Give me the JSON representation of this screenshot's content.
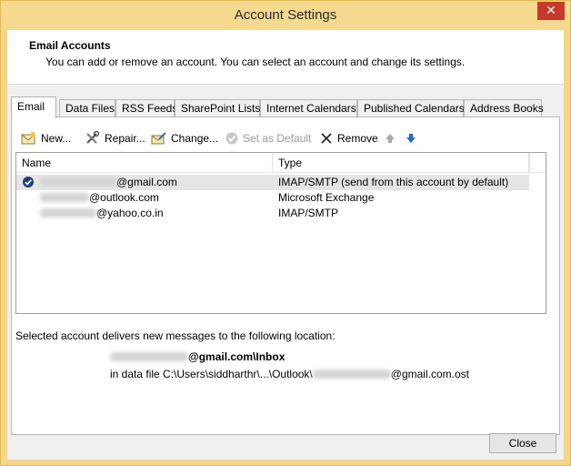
{
  "window": {
    "title": "Account Settings",
    "close_glyph": "✕"
  },
  "header": {
    "title": "Email Accounts",
    "subtitle": "You can add or remove an account. You can select an account and change its settings."
  },
  "tabs": [
    {
      "label": "Email",
      "active": true
    },
    {
      "label": "Data Files"
    },
    {
      "label": "RSS Feeds"
    },
    {
      "label": "SharePoint Lists"
    },
    {
      "label": "Internet Calendars"
    },
    {
      "label": "Published Calendars"
    },
    {
      "label": "Address Books"
    }
  ],
  "toolbar": {
    "new_label": "New...",
    "repair_label": "Repair...",
    "change_label": "Change...",
    "set_default_label": "Set as Default",
    "remove_label": "Remove"
  },
  "accounts": {
    "col_name": "Name",
    "col_type": "Type",
    "rows": [
      {
        "name": "@gmail.com",
        "type": "IMAP/SMTP (send from this account by default)",
        "selected": true,
        "default": true
      },
      {
        "name": "@outlook.com",
        "type": "Microsoft Exchange"
      },
      {
        "name": "@yahoo.co.in",
        "type": "IMAP/SMTP"
      }
    ]
  },
  "location": {
    "label": "Selected account delivers new messages to the following location:",
    "inbox": "@gmail.com\\Inbox",
    "file_prefix": "in data file C:\\Users\\siddharthr\\...\\Outlook\\",
    "file_suffix": "@gmail.com.ost"
  },
  "footer": {
    "close_label": "Close"
  },
  "colors": {
    "title_bar": "#f5d98e",
    "close_red": "#c7392c",
    "arrow_blue": "#2a65c9"
  }
}
